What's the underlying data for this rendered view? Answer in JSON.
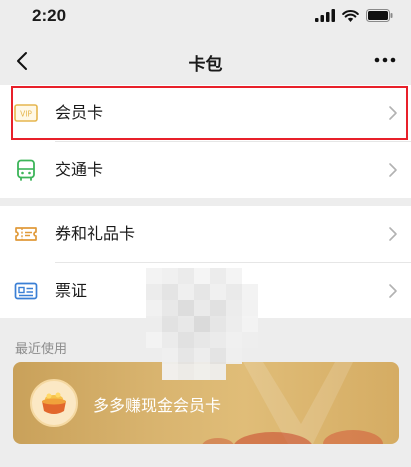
{
  "status_bar": {
    "time": "2:20"
  },
  "nav": {
    "title": "卡包"
  },
  "sections": [
    {
      "items": [
        {
          "label": "会员卡",
          "icon": "vip-card-icon"
        },
        {
          "label": "交通卡",
          "icon": "bus-icon"
        }
      ]
    },
    {
      "items": [
        {
          "label": "券和礼品卡",
          "icon": "ticket-icon"
        },
        {
          "label": "票证",
          "icon": "id-card-icon"
        }
      ]
    }
  ],
  "recent": {
    "title": "最近使用",
    "card": {
      "name": "多多赚现金会员卡",
      "logo": "gold-pot-icon"
    }
  },
  "colors": {
    "background": "#ededed",
    "highlight_border": "#e8202a",
    "vip_icon": "#e5b64f",
    "bus_icon": "#3cb559",
    "ticket_icon": "#e09a3a",
    "id_icon": "#3a7fd5",
    "card_gold": "#d8b36e"
  }
}
